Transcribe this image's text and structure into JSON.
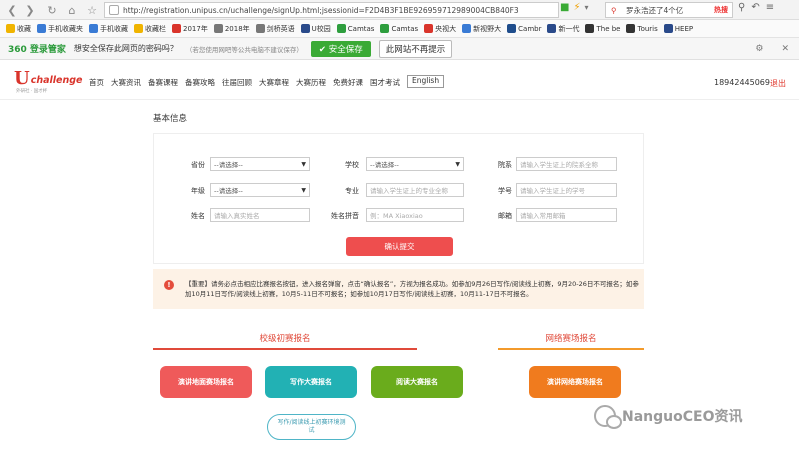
{
  "browser": {
    "url": "http://registration.unipus.cn/uchallenge/signUp.html;jsessionid=F2D4B3F1BE926959712989004CB840F3",
    "search_text": "罗永浩还了4个亿",
    "search_hot": "热搜"
  },
  "bookmarks": [
    {
      "label": "收藏",
      "color": "#f0b400"
    },
    {
      "label": "手机收藏夹",
      "color": "#3a7bd5"
    },
    {
      "label": "手机收藏",
      "color": "#3a7bd5"
    },
    {
      "label": "收藏栏",
      "color": "#f0b400"
    },
    {
      "label": "2017年",
      "color": "#d9342b"
    },
    {
      "label": "2018年",
      "color": "#777777"
    },
    {
      "label": "剑桥英语",
      "color": "#777777"
    },
    {
      "label": "U校园",
      "color": "#2a4a8a"
    },
    {
      "label": "Camtas",
      "color": "#2e9e3e"
    },
    {
      "label": "Camtas",
      "color": "#2e9e3e"
    },
    {
      "label": "央视大",
      "color": "#d9342b"
    },
    {
      "label": "新视野大",
      "color": "#3a7bd5"
    },
    {
      "label": "Cambr",
      "color": "#1f4d8c"
    },
    {
      "label": "新一代",
      "color": "#2a4a8a"
    },
    {
      "label": "The be",
      "color": "#333333"
    },
    {
      "label": "Touris",
      "color": "#333333"
    },
    {
      "label": "HEEP",
      "color": "#2a4a8a"
    }
  ],
  "password_bar": {
    "brand": "360 登录管家",
    "question": "想安全保存此网页的密码吗？",
    "hint": "（若您使用网吧等公共电脑不建议保存）",
    "save_label": "安全保存",
    "no_prompt_label": "此网站不再提示"
  },
  "header": {
    "brand_u": "U",
    "brand_name": "challenge",
    "brand_sub": "外研社 · 国才杯",
    "nav": [
      "首页",
      "大赛资讯",
      "备赛课程",
      "备赛攻略",
      "往届回顾",
      "大赛章程",
      "大赛历程",
      "免费好课",
      "国才考试"
    ],
    "english_label": "English",
    "phone": "18942445069",
    "logout": "退出"
  },
  "form": {
    "section_title": "基本信息",
    "province_label": "省份",
    "province_value": "--请选择--",
    "school_label": "学校",
    "school_value": "--请选择--",
    "college_label": "院系",
    "college_placeholder": "请输入学生证上的院系全称",
    "grade_label": "年级",
    "grade_value": "--请选择--",
    "major_label": "专业",
    "major_placeholder": "请输入学生证上的专业全称",
    "student_id_label": "学号",
    "student_id_placeholder": "请输入学生证上的学号",
    "name_label": "姓名",
    "name_placeholder": "请输入真实姓名",
    "pinyin_label": "姓名拼音",
    "pinyin_placeholder": "例：MA Xiaoxiao",
    "email_label": "邮箱",
    "email_placeholder": "请输入常用邮箱",
    "submit_label": "确认提交"
  },
  "notice": {
    "icon": "!",
    "text": "【重要】请务必点击相应比赛报名按钮，进入报名弹窗，点击“确认报名”，方视为报名成功。如参加9月26日写作/阅读线上初赛，9月20-26日不可报名；如参加10月11日写作/阅读线上初赛，10月5-11日不可报名；如参加10月17日写作/阅读线上初赛，10月11-17日不可报名。"
  },
  "groups": {
    "school_title": "校级初赛报名",
    "online_title": "网络赛场报名",
    "school_line_color": "#e04a3a",
    "online_line_color": "#f39a2b",
    "buttons": [
      {
        "label": "演讲地面赛场报名",
        "color": "#ef5a5a"
      },
      {
        "label": "写作大赛报名",
        "color": "#22b1b4"
      },
      {
        "label": "阅读大赛报名",
        "color": "#6aac1c"
      },
      {
        "label": "演讲网络赛场报名",
        "color": "#f07b1e"
      }
    ],
    "env_test_label": "写作/阅读线上初赛环境测试"
  },
  "watermark": {
    "text": "NanguoCEO资讯"
  }
}
